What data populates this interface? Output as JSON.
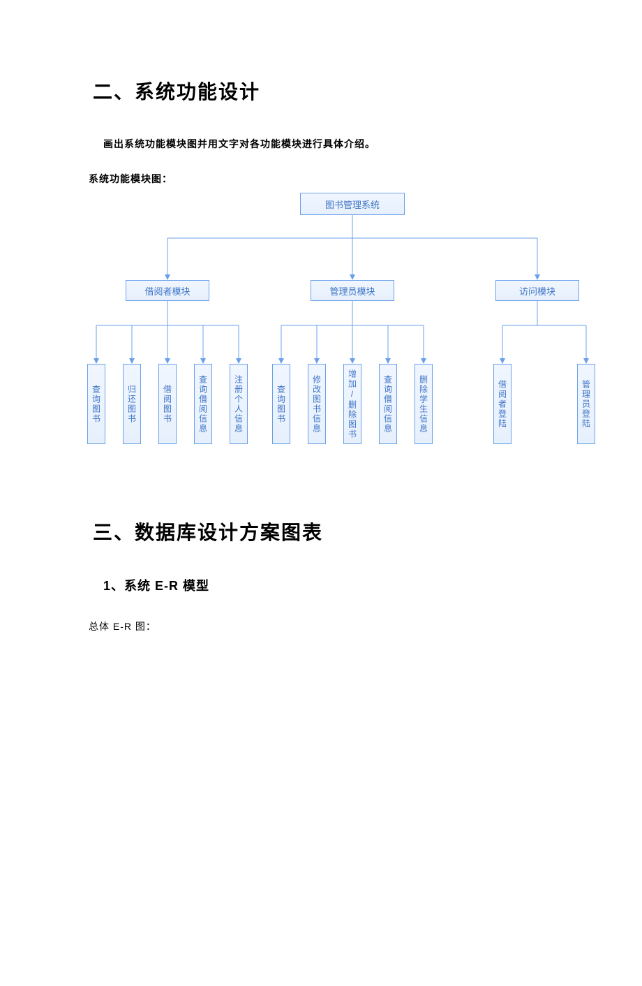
{
  "heading1": "二、系统功能设计",
  "intro": "画出系统功能模块图并用文字对各功能模块进行具体介绍。",
  "subtitle": "系统功能模块图：",
  "chart_data": {
    "type": "tree",
    "root": "图书管理系统",
    "children": [
      {
        "label": "借阅者模块",
        "children": [
          "查询图书",
          "归还图书",
          "借阅图书",
          "查询借阅信息",
          "注册个人信息"
        ]
      },
      {
        "label": "管理员模块",
        "children": [
          "查询图书",
          "修改图书信息",
          "增加/删除图书",
          "查询借阅信息",
          "删除学生信息"
        ]
      },
      {
        "label": "访问模块",
        "children": [
          "借阅者登陆",
          "管理员登陆"
        ]
      }
    ]
  },
  "heading2": "三、数据库设计方案图表",
  "subheading": "1、系统 E-R 模型",
  "er_caption": "总体 E-R 图："
}
